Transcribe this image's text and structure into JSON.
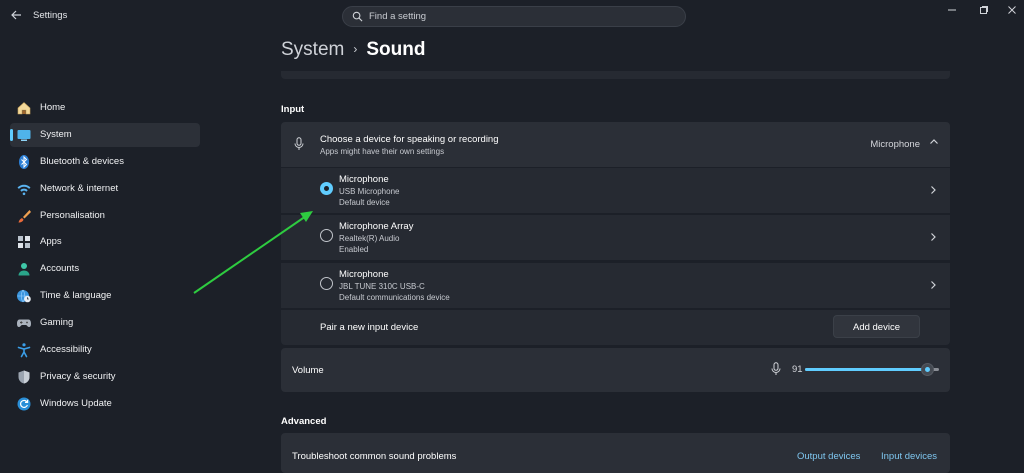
{
  "window": {
    "title": "Settings",
    "search_placeholder": "Find a setting"
  },
  "sidebar": {
    "items": [
      {
        "label": "Home",
        "icon": "home-icon"
      },
      {
        "label": "System",
        "icon": "system-icon",
        "selected": true
      },
      {
        "label": "Bluetooth & devices",
        "icon": "bluetooth-icon"
      },
      {
        "label": "Network & internet",
        "icon": "wifi-icon"
      },
      {
        "label": "Personalisation",
        "icon": "brush-icon"
      },
      {
        "label": "Apps",
        "icon": "apps-icon"
      },
      {
        "label": "Accounts",
        "icon": "accounts-icon"
      },
      {
        "label": "Time & language",
        "icon": "globe-clock-icon"
      },
      {
        "label": "Gaming",
        "icon": "gamepad-icon"
      },
      {
        "label": "Accessibility",
        "icon": "accessibility-icon"
      },
      {
        "label": "Privacy & security",
        "icon": "shield-icon"
      },
      {
        "label": "Windows Update",
        "icon": "update-icon"
      }
    ]
  },
  "breadcrumb": {
    "parent": "System",
    "separator": "›",
    "current": "Sound"
  },
  "input": {
    "section_label": "Input",
    "header_title": "Choose a device for speaking or recording",
    "header_subtitle": "Apps might have their own settings",
    "selected_device": "Microphone",
    "devices": [
      {
        "name": "Microphone",
        "line1": "USB Microphone",
        "line2": "Default device",
        "checked": true
      },
      {
        "name": "Microphone Array",
        "line1": "Realtek(R) Audio",
        "line2": "Enabled",
        "checked": false
      },
      {
        "name": "Microphone",
        "line1": "JBL TUNE 310C USB-C",
        "line2": "Default communications device",
        "checked": false
      }
    ],
    "pair_label": "Pair a new input device",
    "add_button": "Add device",
    "volume_label": "Volume",
    "volume_value": "91",
    "volume_fraction": 0.91
  },
  "advanced": {
    "section_label": "Advanced",
    "troubleshoot_label": "Troubleshoot common sound problems",
    "output_link": "Output devices",
    "input_link": "Input devices"
  },
  "colors": {
    "accent": "#60cdff",
    "annotation_arrow": "#2ecc40"
  }
}
